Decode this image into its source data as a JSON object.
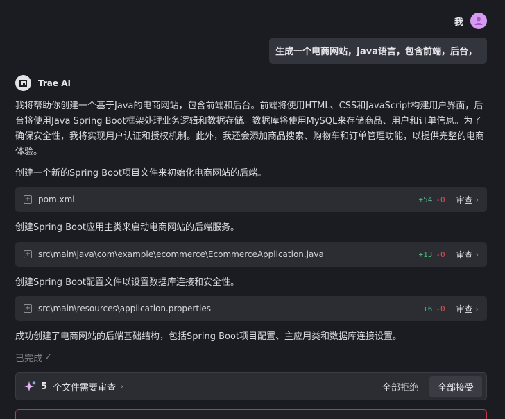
{
  "user": {
    "name": "我",
    "message": "生成一个电商网站，Java语言，包含前端，后台，"
  },
  "ai": {
    "name": "Trae AI"
  },
  "messages": {
    "intro": "我将帮助你创建一个基于Java的电商网站，包含前端和后台。前端将使用HTML、CSS和JavaScript构建用户界面，后台将使用Java Spring Boot框架处理业务逻辑和数据存储。数据库将使用MySQL来存储商品、用户和订单信息。为了确保安全性，我将实现用户认证和授权机制。此外，我还会添加商品搜索、购物车和订单管理功能，以提供完整的电商体验。",
    "step1": "创建一个新的Spring Boot项目文件来初始化电商网站的后端。",
    "step2": "创建Spring Boot应用主类来启动电商网站的后端服务。",
    "step3": "创建Spring Boot配置文件以设置数据库连接和安全性。",
    "summary": "成功创建了电商网站的后端基础结构，包括Spring Boot项目配置、主应用类和数据库连接设置。"
  },
  "files": [
    {
      "name": "pom.xml",
      "added": "+54",
      "removed": "-0",
      "review_label": "审查"
    },
    {
      "name": "src\\main\\java\\com\\example\\ecommerce\\EcommerceApplication.java",
      "added": "+13",
      "removed": "-0",
      "review_label": "审查"
    },
    {
      "name": "src\\main\\resources\\application.properties",
      "added": "+6",
      "removed": "-0",
      "review_label": "审查"
    }
  ],
  "status": {
    "done_label": "已完成",
    "check_icon": "✓"
  },
  "review_bar": {
    "count": "5",
    "text": "个文件需要审查",
    "reject_all": "全部拒绝",
    "accept_all": "全部接受"
  },
  "colors": {
    "added": "#4fb583",
    "removed": "#e05050",
    "avatar": "#d69bf0"
  }
}
